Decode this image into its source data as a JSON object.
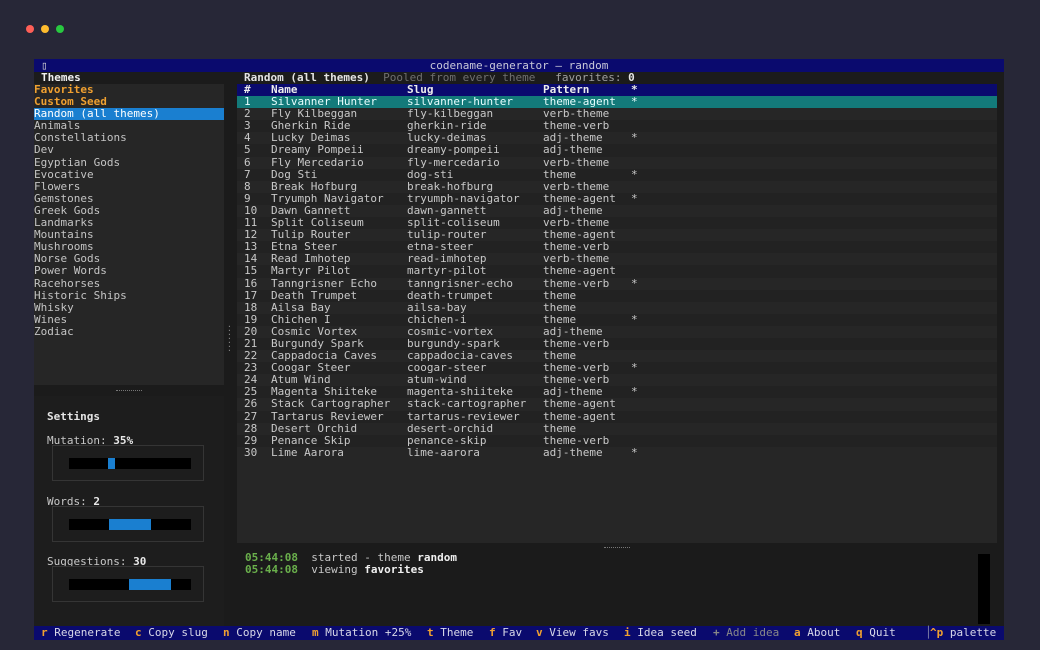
{
  "window": {
    "title": "codename-generator — random"
  },
  "colors": {
    "accent": "#1a7fd0",
    "selected_row": "#137a7a",
    "highlight": "#f0a030",
    "header_bg": "#0a0a6e"
  },
  "sidebar": {
    "title": "Themes",
    "items": [
      {
        "label": "Favorites",
        "style": "fav"
      },
      {
        "label": "Custom Seed",
        "style": "fav"
      },
      {
        "label": "Random (all themes)",
        "style": "sel"
      },
      {
        "label": "Animals",
        "style": ""
      },
      {
        "label": "Constellations",
        "style": ""
      },
      {
        "label": "Dev",
        "style": ""
      },
      {
        "label": "Egyptian Gods",
        "style": ""
      },
      {
        "label": "Evocative",
        "style": ""
      },
      {
        "label": "Flowers",
        "style": ""
      },
      {
        "label": "Gemstones",
        "style": ""
      },
      {
        "label": "Greek Gods",
        "style": ""
      },
      {
        "label": "Landmarks",
        "style": ""
      },
      {
        "label": "Mountains",
        "style": ""
      },
      {
        "label": "Mushrooms",
        "style": ""
      },
      {
        "label": "Norse Gods",
        "style": ""
      },
      {
        "label": "Power Words",
        "style": ""
      },
      {
        "label": "Racehorses",
        "style": ""
      },
      {
        "label": "Historic Ships",
        "style": ""
      },
      {
        "label": "Whisky",
        "style": ""
      },
      {
        "label": "Wines",
        "style": ""
      },
      {
        "label": "Zodiac",
        "style": ""
      }
    ]
  },
  "settings": {
    "title": "Settings",
    "mutation": {
      "label": "Mutation:",
      "value": "35%",
      "level": 0.35
    },
    "words": {
      "label": "Words:",
      "value": "2",
      "level": 0.5
    },
    "suggestions": {
      "label": "Suggestions:",
      "value": "30",
      "level": 0.66
    }
  },
  "header": {
    "theme": "Random (all themes)",
    "description": "Pooled from every theme",
    "favorites_label": "favorites:",
    "favorites_count": "0"
  },
  "table": {
    "columns": [
      "#",
      "Name",
      "Slug",
      "Pattern",
      "*"
    ],
    "rows": [
      [
        "1",
        "Silvanner Hunter",
        "silvanner-hunter",
        "theme-agent",
        "*"
      ],
      [
        "2",
        "Fly Kilbeggan",
        "fly-kilbeggan",
        "verb-theme",
        ""
      ],
      [
        "3",
        "Gherkin Ride",
        "gherkin-ride",
        "theme-verb",
        ""
      ],
      [
        "4",
        "Lucky Deimas",
        "lucky-deimas",
        "adj-theme",
        "*"
      ],
      [
        "5",
        "Dreamy Pompeii",
        "dreamy-pompeii",
        "adj-theme",
        ""
      ],
      [
        "6",
        "Fly Mercedario",
        "fly-mercedario",
        "verb-theme",
        ""
      ],
      [
        "7",
        "Dog Sti",
        "dog-sti",
        "theme",
        "*"
      ],
      [
        "8",
        "Break Hofburg",
        "break-hofburg",
        "verb-theme",
        ""
      ],
      [
        "9",
        "Tryumph Navigator",
        "tryumph-navigator",
        "theme-agent",
        "*"
      ],
      [
        "10",
        "Dawn Gannett",
        "dawn-gannett",
        "adj-theme",
        ""
      ],
      [
        "11",
        "Split Coliseum",
        "split-coliseum",
        "verb-theme",
        ""
      ],
      [
        "12",
        "Tulip Router",
        "tulip-router",
        "theme-agent",
        ""
      ],
      [
        "13",
        "Etna Steer",
        "etna-steer",
        "theme-verb",
        ""
      ],
      [
        "14",
        "Read Imhotep",
        "read-imhotep",
        "verb-theme",
        ""
      ],
      [
        "15",
        "Martyr Pilot",
        "martyr-pilot",
        "theme-agent",
        ""
      ],
      [
        "16",
        "Tanngrisner Echo",
        "tanngrisner-echo",
        "theme-verb",
        "*"
      ],
      [
        "17",
        "Death Trumpet",
        "death-trumpet",
        "theme",
        ""
      ],
      [
        "18",
        "Ailsa Bay",
        "ailsa-bay",
        "theme",
        ""
      ],
      [
        "19",
        "Chichen I",
        "chichen-i",
        "theme",
        "*"
      ],
      [
        "20",
        "Cosmic Vortex",
        "cosmic-vortex",
        "adj-theme",
        ""
      ],
      [
        "21",
        "Burgundy Spark",
        "burgundy-spark",
        "theme-verb",
        ""
      ],
      [
        "22",
        "Cappadocia Caves",
        "cappadocia-caves",
        "theme",
        ""
      ],
      [
        "23",
        "Coogar Steer",
        "coogar-steer",
        "theme-verb",
        "*"
      ],
      [
        "24",
        "Atum Wind",
        "atum-wind",
        "theme-verb",
        ""
      ],
      [
        "25",
        "Magenta Shiiteke",
        "magenta-shiiteke",
        "adj-theme",
        "*"
      ],
      [
        "26",
        "Stack Cartographer",
        "stack-cartographer",
        "theme-agent",
        ""
      ],
      [
        "27",
        "Tartarus Reviewer",
        "tartarus-reviewer",
        "theme-agent",
        ""
      ],
      [
        "28",
        "Desert Orchid",
        "desert-orchid",
        "theme",
        ""
      ],
      [
        "29",
        "Penance Skip",
        "penance-skip",
        "theme-verb",
        ""
      ],
      [
        "30",
        "Lime Aarora",
        "lime-aarora",
        "adj-theme",
        "*"
      ]
    ]
  },
  "log": [
    {
      "time": "05:44:08",
      "text": "started - theme ",
      "strong": "random"
    },
    {
      "time": "05:44:08",
      "text": "viewing ",
      "strong": "favorites"
    }
  ],
  "footer": {
    "keys": [
      {
        "key": "r",
        "label": "Regenerate"
      },
      {
        "key": "c",
        "label": "Copy slug"
      },
      {
        "key": "n",
        "label": "Copy name"
      },
      {
        "key": "m",
        "label": "Mutation +25%"
      },
      {
        "key": "t",
        "label": "Theme"
      },
      {
        "key": "f",
        "label": "Fav"
      },
      {
        "key": "v",
        "label": "View favs"
      },
      {
        "key": "i",
        "label": "Idea seed"
      },
      {
        "key": "+",
        "label": "Add idea"
      },
      {
        "key": "a",
        "label": "About"
      },
      {
        "key": "q",
        "label": "Quit"
      }
    ],
    "palette": {
      "key": "^p",
      "label": "palette"
    }
  }
}
